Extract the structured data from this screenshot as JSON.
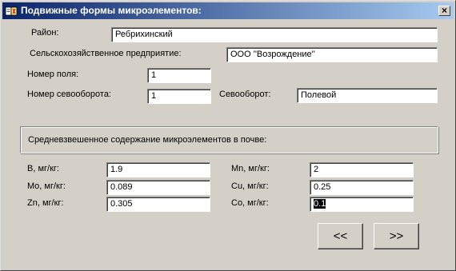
{
  "window": {
    "title": "Подвижные формы микроэлементов:"
  },
  "region": {
    "label": "Район:",
    "value": "Ребрихинский"
  },
  "enterprise": {
    "label": "Сельскохозяйственное предприятие:",
    "value": "ООО ''Возрождение''"
  },
  "field_number": {
    "label": "Номер поля:",
    "value": "1"
  },
  "rotation_number": {
    "label": "Номер севооборота:",
    "value": "1"
  },
  "rotation": {
    "label": "Севооборот:",
    "value": "Полевой"
  },
  "group": {
    "label": "Средневзвешенное содержание микроэлементов в почве:"
  },
  "elements": {
    "b": {
      "label": "B, мг/кг:",
      "value": "1.9"
    },
    "mo": {
      "label": "Mo,  мг/кг:",
      "value": "0.089"
    },
    "zn": {
      "label": "Zn, мг/кг:",
      "value": "0.305"
    },
    "mn": {
      "label": "Mn, мг/кг:",
      "value": "2"
    },
    "cu": {
      "label": "Cu, мг/кг:",
      "value": "0.25"
    },
    "co": {
      "label": "Co, мг/кг:",
      "value": "0.1"
    }
  },
  "nav": {
    "prev_label": "<<",
    "next_label": ">>"
  },
  "close_glyph": "×"
}
